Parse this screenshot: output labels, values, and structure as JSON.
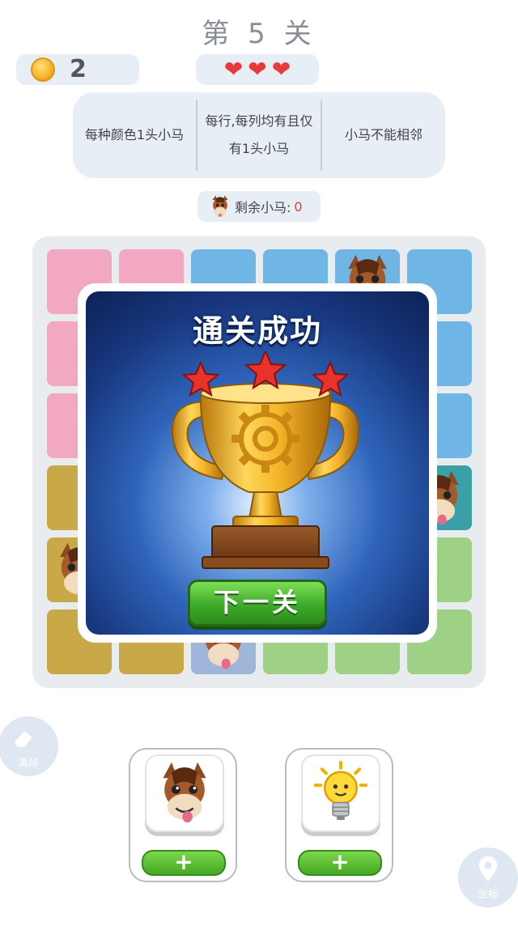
{
  "header": {
    "level_title": "第 5 关"
  },
  "status": {
    "coins": "2",
    "hearts": 3
  },
  "rules": [
    {
      "text": "每种颜色1头小马"
    },
    {
      "text": "每行,每列均有且仅有1头小马"
    },
    {
      "text": "小马不能相邻"
    }
  ],
  "remaining": {
    "label": "剩余小马:",
    "value": "0"
  },
  "board": {
    "rows": 6,
    "cols": 6,
    "colors": {
      "pink": "#f3a8c2",
      "blue": "#6fb5e6",
      "mustard": "#c9a847",
      "teal": "#3a9fa6",
      "green": "#9ed185",
      "slate": "#9fb5d9"
    },
    "cells": [
      [
        "pink",
        "pink",
        "blue",
        "blue",
        "blue",
        "blue"
      ],
      [
        "pink",
        "pink",
        "blue",
        "blue",
        "blue",
        "blue"
      ],
      [
        "pink",
        "pink",
        "blue",
        "blue",
        "blue",
        "blue"
      ],
      [
        "mustard",
        "mustard",
        "blue",
        "blue",
        "blue",
        "teal"
      ],
      [
        "mustard",
        "mustard",
        "green",
        "green",
        "green",
        "green"
      ],
      [
        "mustard",
        "mustard",
        "slate",
        "green",
        "green",
        "green"
      ]
    ],
    "horses": [
      [
        0,
        4
      ],
      [
        3,
        5
      ],
      [
        4,
        0
      ],
      [
        5,
        2
      ]
    ]
  },
  "win_dialog": {
    "title": "通关成功",
    "next_button": "下一关",
    "stars": 3
  },
  "tools": [
    {
      "name": "horse-tool",
      "icon": "horse-face-icon",
      "button": "+"
    },
    {
      "name": "hint-tool",
      "icon": "lightbulb-icon",
      "button": "+"
    }
  ],
  "side_buttons": {
    "clear": {
      "label": "清除",
      "icon": "eraser-icon"
    },
    "coord": {
      "label": "坐标",
      "icon": "location-pin-icon"
    }
  }
}
